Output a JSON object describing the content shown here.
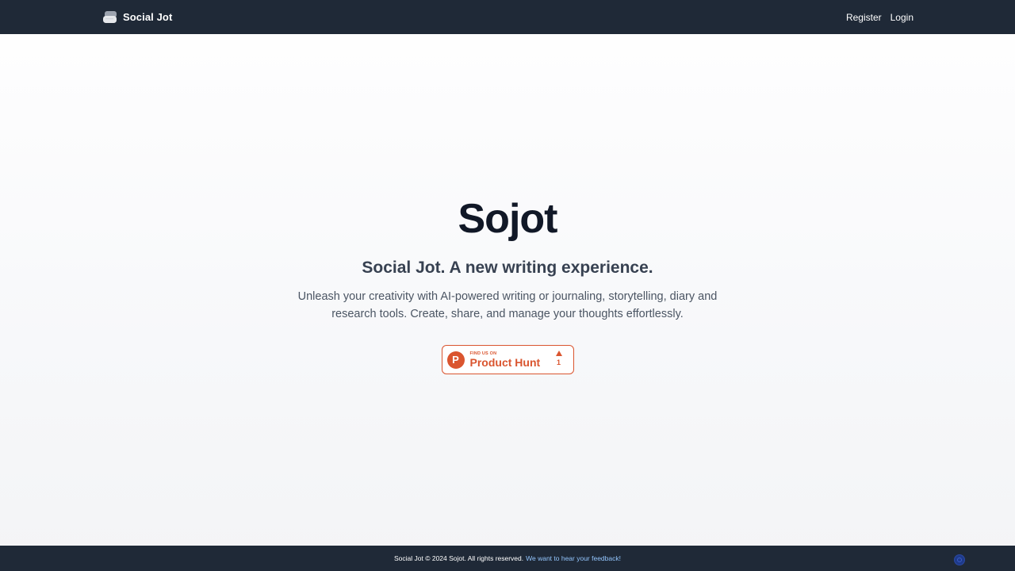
{
  "navbar": {
    "brand_icon": "chat-bubbles-icon",
    "brand_name": "Social Jot",
    "links": [
      {
        "label": "Register"
      },
      {
        "label": "Login"
      }
    ]
  },
  "hero": {
    "title": "Sojot",
    "subtitle": "Social Jot. A new writing experience.",
    "description": "Unleash your creativity with AI-powered writing or journaling, storytelling, diary and research tools. Create, share, and manage your thoughts effortlessly."
  },
  "product_hunt_badge": {
    "logo_letter": "P",
    "small_text": "FIND US ON",
    "big_text": "Product Hunt",
    "upvote_icon": "triangle-up-icon",
    "votes": "1",
    "color": "#da552f"
  },
  "footer": {
    "copyright": "Social Jot © 2024 Sojot. All rights reserved.",
    "feedback_link": "We want to hear your feedback!"
  },
  "chat_widget": {
    "icon": "chat-widget-icon"
  },
  "colors": {
    "nav_bg": "#1f2937",
    "title": "#111827",
    "link_blue": "#93c5fd"
  }
}
